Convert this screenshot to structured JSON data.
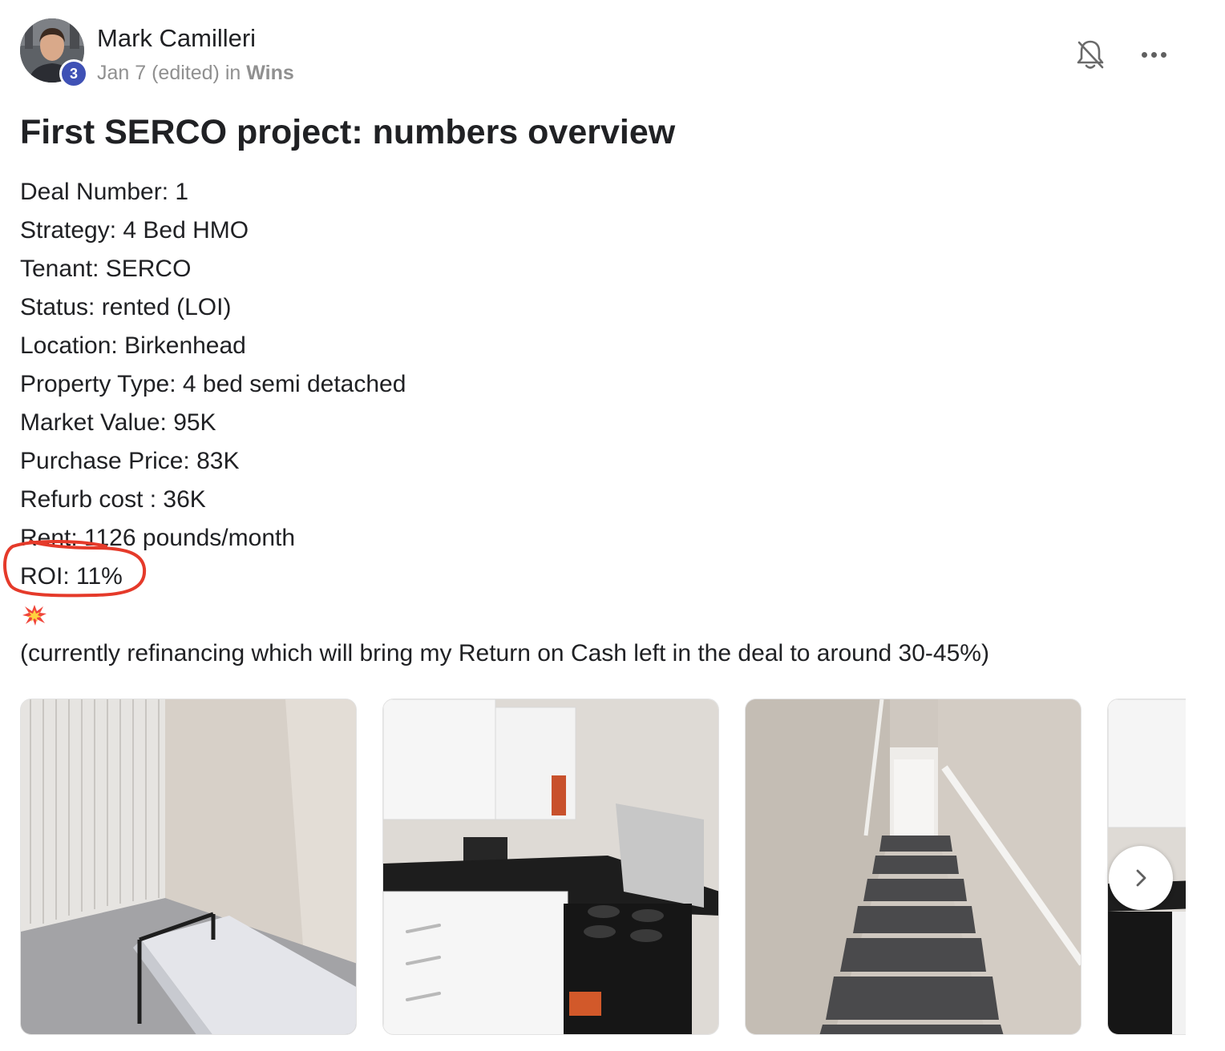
{
  "post": {
    "author": {
      "name": "Mark Camilleri",
      "level": "3"
    },
    "meta": {
      "date": "Jan 7 (edited)",
      "in_label": "in",
      "category": "Wins"
    },
    "title": "First SERCO project: numbers overview",
    "lines": [
      "Deal Number: 1",
      "Strategy: 4 Bed HMO",
      "Tenant: SERCO",
      "Status: rented (LOI)",
      "Location: Birkenhead",
      "Property Type: 4 bed semi detached",
      "Market Value: 95K",
      "Purchase Price: 83K",
      "Refurb cost : 36K",
      "Rent: 1126 pounds/month",
      "ROI: 11%"
    ],
    "emoji_icon": "collision-icon",
    "closing_text": "(currently refinancing which will bring my Return on Cash left in the deal to around 30-45%)"
  },
  "actions": {
    "notification_icon": "bell-off-icon",
    "more_icon": "more-horizontal-icon",
    "next_icon": "chevron-right-icon"
  },
  "gallery": {
    "photos": [
      "bedroom-photo",
      "kitchen-photo",
      "staircase-photo",
      "kitchen-partial-photo"
    ]
  },
  "colors": {
    "level_badge": "#3f51b5",
    "annotation_circle": "#e53a2a",
    "meta_text": "#909090"
  }
}
